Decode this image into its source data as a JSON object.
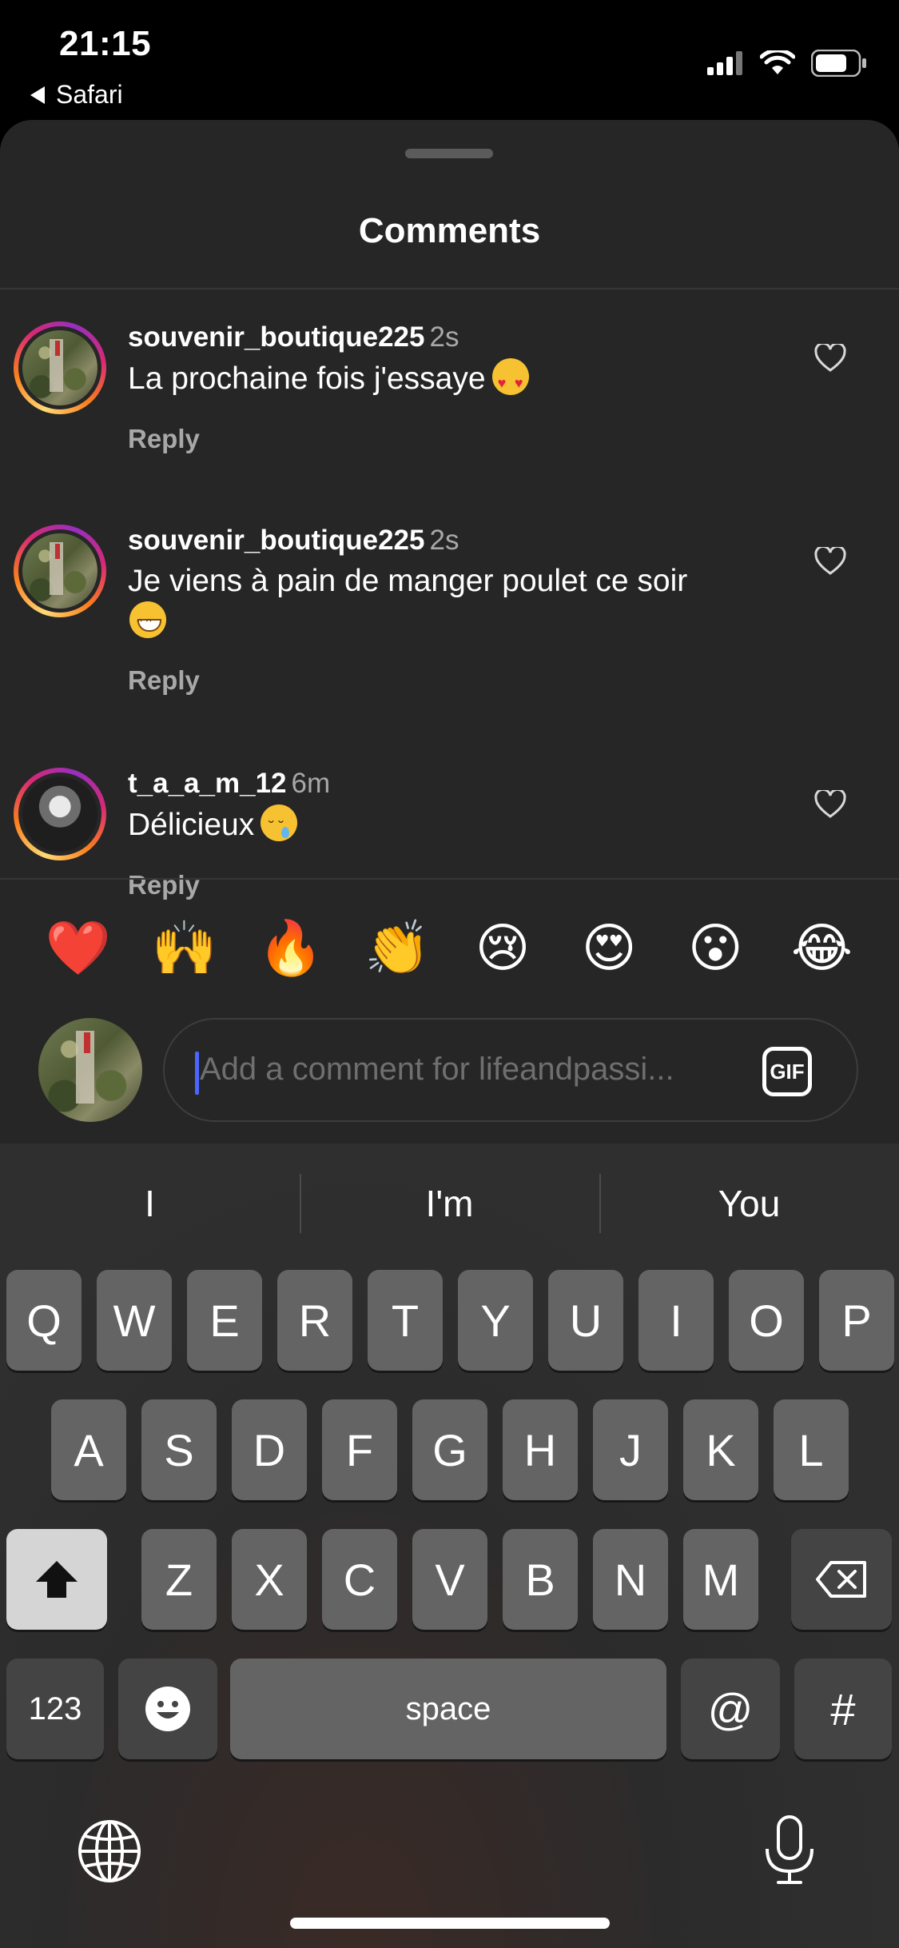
{
  "status_bar": {
    "time": "21:15",
    "back_app": "Safari"
  },
  "sheet": {
    "title": "Comments"
  },
  "comments": [
    {
      "username": "souvenir_boutique225",
      "time": "2s",
      "text": "La prochaine fois j'essaye",
      "emoji": "smiling-face-with-heart-eyes",
      "reply_label": "Reply"
    },
    {
      "username": "souvenir_boutique225",
      "time": "2s",
      "text": "Je viens à pain de manger poulet ce soir",
      "emoji": "grinning-face-with-smiling-eyes",
      "reply_label": "Reply"
    },
    {
      "username": "t_a_a_m_12",
      "time": "6m",
      "text": "Délicieux",
      "emoji": "drooling-face",
      "reply_label": "Reply"
    }
  ],
  "reactions": [
    "❤️",
    "🙌",
    "🔥",
    "👏",
    "😢",
    "😍",
    "😮",
    "😂"
  ],
  "composer": {
    "placeholder": "Add a comment for lifeandpassi...",
    "gif_label": "GIF"
  },
  "keyboard": {
    "suggestions": [
      "I",
      "I'm",
      "You"
    ],
    "row1": [
      "Q",
      "W",
      "E",
      "R",
      "T",
      "Y",
      "U",
      "I",
      "O",
      "P"
    ],
    "row2": [
      "A",
      "S",
      "D",
      "F",
      "G",
      "H",
      "J",
      "K",
      "L"
    ],
    "row3": [
      "Z",
      "X",
      "C",
      "V",
      "B",
      "N",
      "M"
    ],
    "numbers_label": "123",
    "space_label": "space",
    "at_label": "@",
    "hash_label": "#"
  },
  "colors": {
    "sheet_bg": "#262626",
    "secondary_text": "#a8a8a8",
    "cursor": "#4a66ff"
  }
}
